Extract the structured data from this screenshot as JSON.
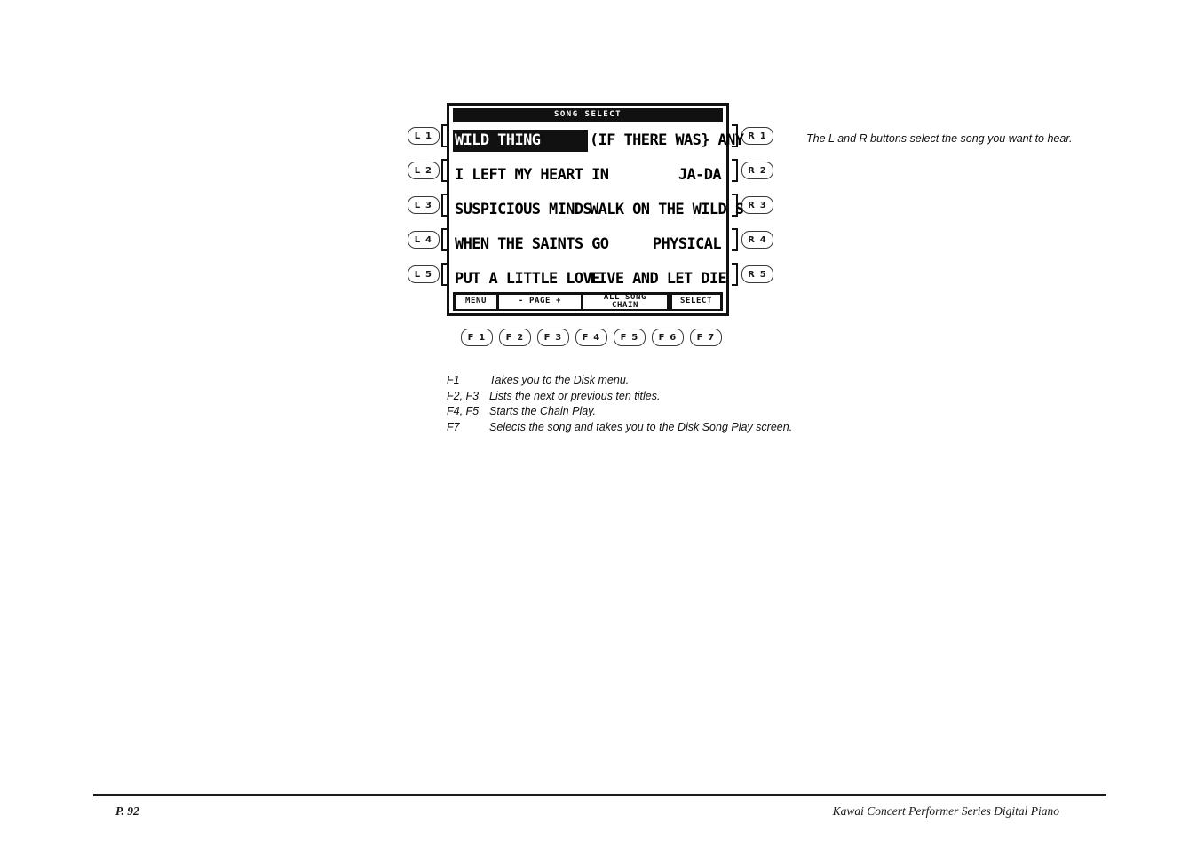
{
  "lcd": {
    "title": "SONG SELECT",
    "rows": [
      {
        "left": "WILD THING",
        "left_selected": true,
        "right": "(IF THERE WAS} ANY",
        "right_selected": false
      },
      {
        "left": "I LEFT MY HEART IN",
        "left_selected": false,
        "right": "JA-DA",
        "right_selected": false
      },
      {
        "left": "SUSPICIOUS MINDS",
        "left_selected": false,
        "right": "WALK ON THE WILD S",
        "right_selected": false
      },
      {
        "left": "WHEN THE SAINTS GO",
        "left_selected": false,
        "right": "PHYSICAL",
        "right_selected": false
      },
      {
        "left": "PUT A LITTLE LOVE",
        "left_selected": false,
        "right": "LIVE AND LET DIE",
        "right_selected": false
      }
    ],
    "softkeys": {
      "menu": "MENU",
      "page": "- PAGE +",
      "chain_line1": "ALL SONG",
      "chain_line2": "CHAIN",
      "select": "SELECT"
    }
  },
  "left_buttons": [
    {
      "label": "L 1"
    },
    {
      "label": "L 2"
    },
    {
      "label": "L 3"
    },
    {
      "label": "L 4"
    },
    {
      "label": "L 5"
    }
  ],
  "right_buttons": [
    {
      "label": "R 1"
    },
    {
      "label": "R 2"
    },
    {
      "label": "R 3"
    },
    {
      "label": "R 4"
    },
    {
      "label": "R 5"
    }
  ],
  "function_buttons": [
    {
      "label": "F 1"
    },
    {
      "label": "F 2"
    },
    {
      "label": "F 3"
    },
    {
      "label": "F 4"
    },
    {
      "label": "F 5"
    },
    {
      "label": "F 6"
    },
    {
      "label": "F 7"
    }
  ],
  "side_note": "The L and R buttons select the song you want to hear.",
  "legend": [
    {
      "key": "F1",
      "desc": "Takes you to the Disk menu."
    },
    {
      "key": "F2, F3",
      "desc": "Lists the next or previous ten titles."
    },
    {
      "key": "F4, F5",
      "desc": "Starts the Chain Play."
    },
    {
      "key": "F7",
      "desc": "Selects the song and takes you to the Disk Song Play screen."
    }
  ],
  "footer": {
    "page": "P. 92",
    "brand": "Kawai Concert Performer Series Digital Piano"
  },
  "colors": {
    "ink": "#111111",
    "paper": "#ffffff",
    "button_outline": "#3a3a3a"
  }
}
